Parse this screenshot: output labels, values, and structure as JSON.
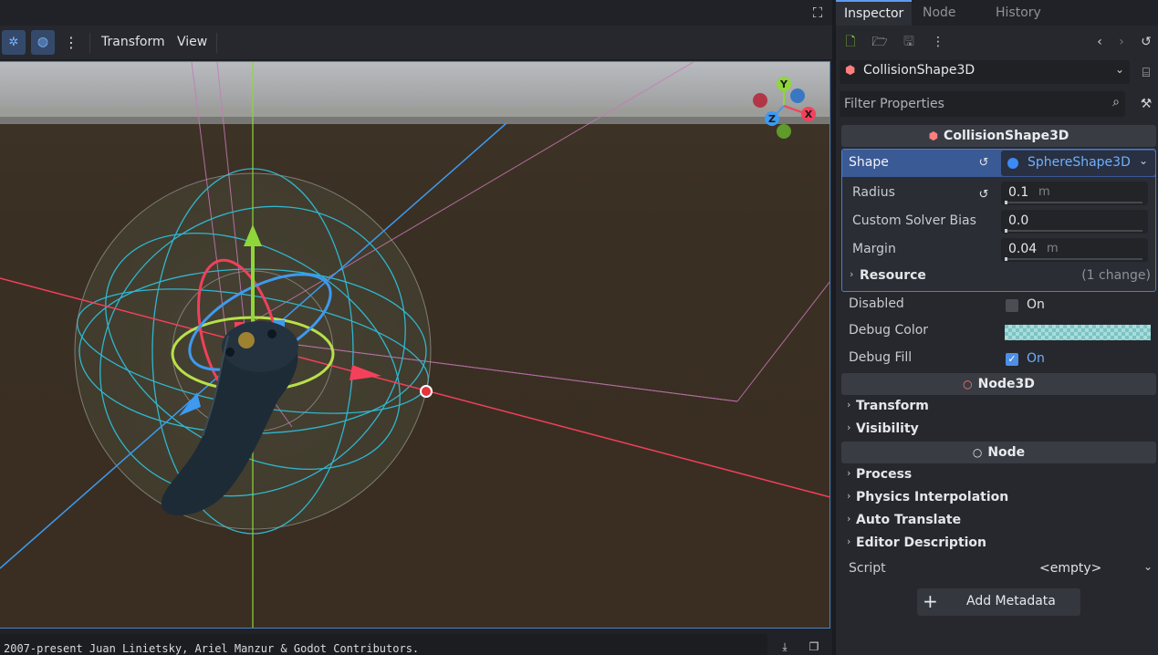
{
  "editor": {
    "fullscreen_icon": "fullscreen-icon",
    "toolbar": {
      "menu_transform": "Transform",
      "menu_view": "View"
    },
    "status_text": "2007-present Juan Linietsky, Ariel Manzur & Godot Contributors."
  },
  "gizmo_axes": {
    "y": "Y",
    "x": "X",
    "z": "Z"
  },
  "inspector": {
    "tabs": [
      {
        "label": "Inspector",
        "active": true
      },
      {
        "label": "Node",
        "active": false
      },
      {
        "label": "History",
        "active": false
      }
    ],
    "object_name": "CollisionShape3D",
    "filter_placeholder": "Filter Properties",
    "sections": {
      "collision_shape": {
        "title": "CollisionShape3D",
        "shape_label": "Shape",
        "shape_value": "SphereShape3D",
        "radius_label": "Radius",
        "radius_value": "0.1",
        "radius_unit": "m",
        "bias_label": "Custom Solver Bias",
        "bias_value": "0.0",
        "margin_label": "Margin",
        "margin_value": "0.04",
        "margin_unit": "m",
        "resource_label": "Resource",
        "resource_changes": "(1 change)",
        "disabled_label": "Disabled",
        "disabled_value": "On",
        "disabled_checked": false,
        "debug_color_label": "Debug Color",
        "debug_fill_label": "Debug Fill",
        "debug_fill_value": "On",
        "debug_fill_checked": true
      },
      "node3d": {
        "title": "Node3D",
        "items": [
          "Transform",
          "Visibility"
        ]
      },
      "node": {
        "title": "Node",
        "items": [
          "Process",
          "Physics Interpolation",
          "Auto Translate",
          "Editor Description"
        ],
        "script_label": "Script",
        "script_value": "<empty>"
      }
    },
    "add_metadata_label": "Add Metadata"
  },
  "colors": {
    "accent": "#5d9bf0",
    "x_axis": "#f5405c",
    "y_axis": "#8fd63b",
    "z_axis": "#3d9af0",
    "debug_color": "#7cc4c4"
  }
}
